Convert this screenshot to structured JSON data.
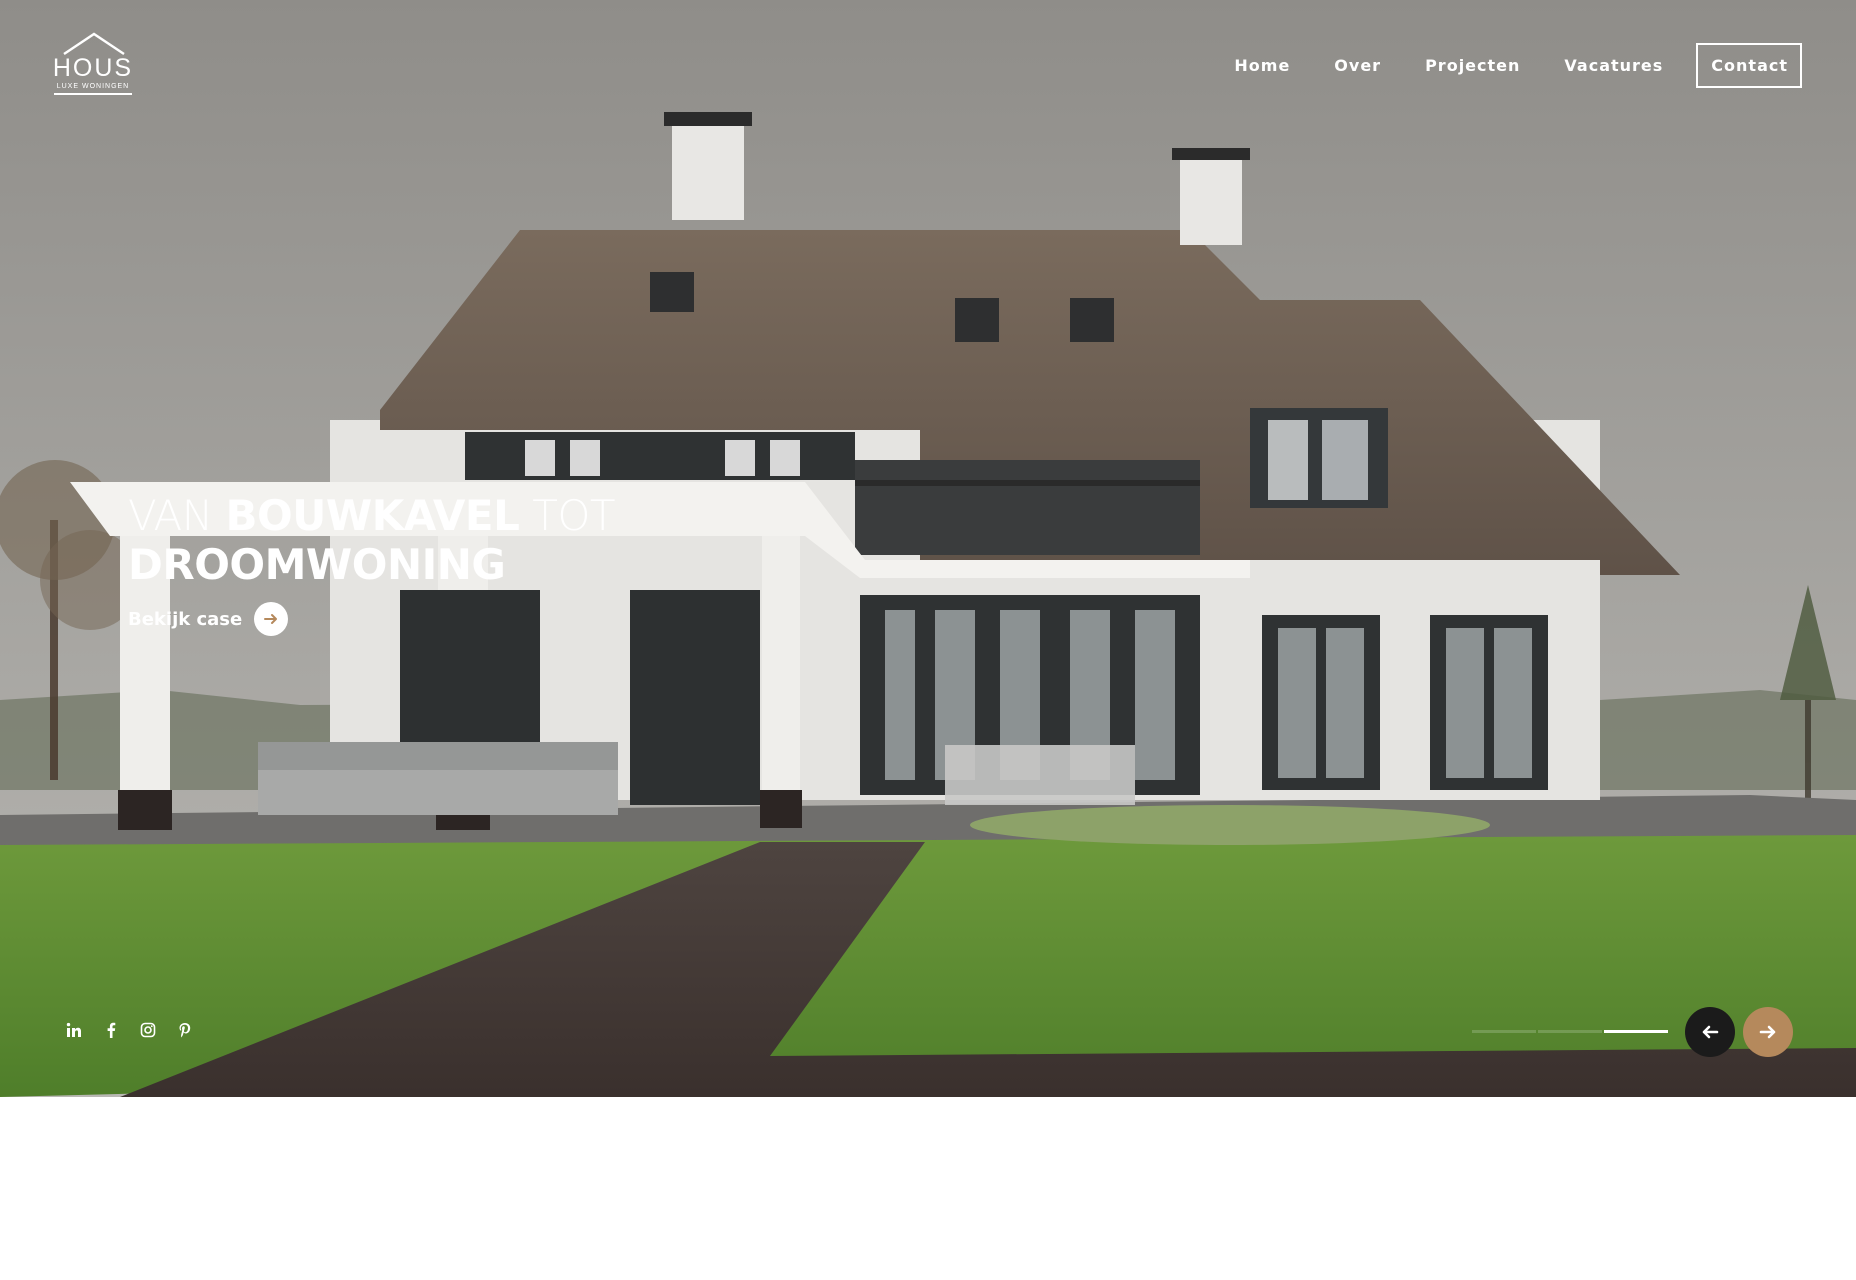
{
  "brand": {
    "name": "HOUS",
    "tagline": "LUXE WONINGEN"
  },
  "nav": {
    "items": [
      "Home",
      "Over",
      "Projecten",
      "Vacatures"
    ],
    "contact": "Contact"
  },
  "hero": {
    "headline_part1": "VAN ",
    "headline_part2": "BOUWKAVEL",
    "headline_part3": " TOT",
    "headline_line2": "DROOMWONING",
    "cta_label": "Bekijk case",
    "cta_icon": "arrow-right-icon"
  },
  "social": {
    "icons": [
      "linkedin-icon",
      "facebook-icon",
      "instagram-icon",
      "pinterest-icon"
    ]
  },
  "slider": {
    "total_slides": 3,
    "active_slide": 3
  },
  "colors": {
    "accent": "#b5895c",
    "dark_button": "#1b1b1b",
    "text": "#ffffff"
  }
}
